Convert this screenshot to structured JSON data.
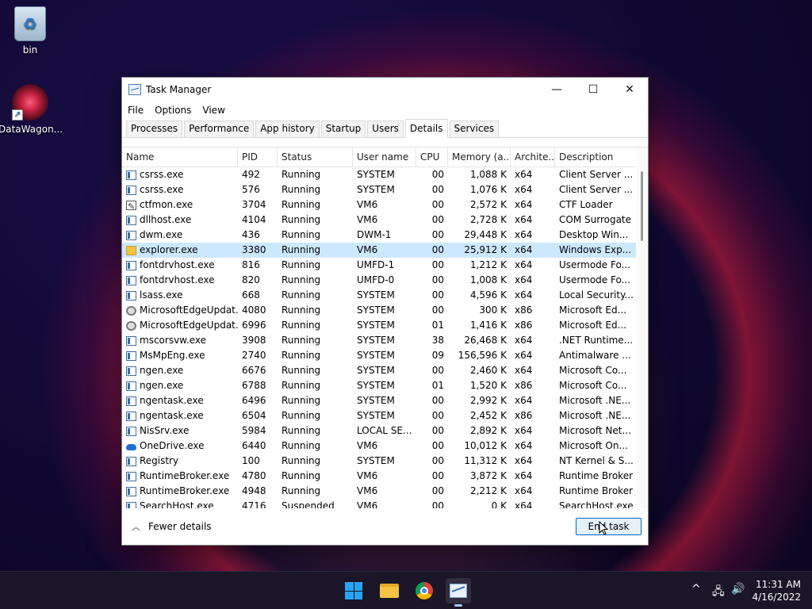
{
  "desktop": {
    "icons": [
      {
        "label": "bin"
      },
      {
        "label": "DataWagon..."
      }
    ]
  },
  "window": {
    "title": "Task Manager",
    "controls": {
      "minimize": "—",
      "maximize": "☐",
      "close": "✕"
    },
    "menu": [
      "File",
      "Options",
      "View"
    ],
    "tabs": [
      "Processes",
      "Performance",
      "App history",
      "Startup",
      "Users",
      "Details",
      "Services"
    ],
    "active_tab": "Details",
    "columns": [
      "Name",
      "PID",
      "Status",
      "User name",
      "CPU",
      "Memory (a...",
      "Archite...",
      "Description"
    ],
    "rows": [
      {
        "icon": "generic",
        "name": "csrss.exe",
        "pid": "492",
        "status": "Running",
        "user": "SYSTEM",
        "cpu": "00",
        "mem": "1,088 K",
        "arch": "x64",
        "desc": "Client Server ..."
      },
      {
        "icon": "generic",
        "name": "csrss.exe",
        "pid": "576",
        "status": "Running",
        "user": "SYSTEM",
        "cpu": "00",
        "mem": "1,076 K",
        "arch": "x64",
        "desc": "Client Server ..."
      },
      {
        "icon": "pen",
        "name": "ctfmon.exe",
        "pid": "3704",
        "status": "Running",
        "user": "VM6",
        "cpu": "00",
        "mem": "2,572 K",
        "arch": "x64",
        "desc": "CTF Loader"
      },
      {
        "icon": "generic",
        "name": "dllhost.exe",
        "pid": "4104",
        "status": "Running",
        "user": "VM6",
        "cpu": "00",
        "mem": "2,728 K",
        "arch": "x64",
        "desc": "COM Surrogate"
      },
      {
        "icon": "generic",
        "name": "dwm.exe",
        "pid": "436",
        "status": "Running",
        "user": "DWM-1",
        "cpu": "00",
        "mem": "29,448 K",
        "arch": "x64",
        "desc": "Desktop Win..."
      },
      {
        "icon": "folder",
        "name": "explorer.exe",
        "pid": "3380",
        "status": "Running",
        "user": "VM6",
        "cpu": "00",
        "mem": "25,912 K",
        "arch": "x64",
        "desc": "Windows Exp...",
        "selected": true
      },
      {
        "icon": "generic",
        "name": "fontdrvhost.exe",
        "pid": "816",
        "status": "Running",
        "user": "UMFD-1",
        "cpu": "00",
        "mem": "1,212 K",
        "arch": "x64",
        "desc": "Usermode Fo..."
      },
      {
        "icon": "generic",
        "name": "fontdrvhost.exe",
        "pid": "820",
        "status": "Running",
        "user": "UMFD-0",
        "cpu": "00",
        "mem": "1,008 K",
        "arch": "x64",
        "desc": "Usermode Fo..."
      },
      {
        "icon": "generic",
        "name": "lsass.exe",
        "pid": "668",
        "status": "Running",
        "user": "SYSTEM",
        "cpu": "00",
        "mem": "4,596 K",
        "arch": "x64",
        "desc": "Local Security..."
      },
      {
        "icon": "gear",
        "name": "MicrosoftEdgeUpdat...",
        "pid": "4080",
        "status": "Running",
        "user": "SYSTEM",
        "cpu": "00",
        "mem": "300 K",
        "arch": "x86",
        "desc": "Microsoft Ed..."
      },
      {
        "icon": "gear",
        "name": "MicrosoftEdgeUpdat...",
        "pid": "6996",
        "status": "Running",
        "user": "SYSTEM",
        "cpu": "01",
        "mem": "1,416 K",
        "arch": "x86",
        "desc": "Microsoft Ed..."
      },
      {
        "icon": "generic",
        "name": "mscorsvw.exe",
        "pid": "3908",
        "status": "Running",
        "user": "SYSTEM",
        "cpu": "38",
        "mem": "26,468 K",
        "arch": "x64",
        "desc": ".NET Runtime..."
      },
      {
        "icon": "generic",
        "name": "MsMpEng.exe",
        "pid": "2740",
        "status": "Running",
        "user": "SYSTEM",
        "cpu": "09",
        "mem": "156,596 K",
        "arch": "x64",
        "desc": "Antimalware ..."
      },
      {
        "icon": "generic",
        "name": "ngen.exe",
        "pid": "6676",
        "status": "Running",
        "user": "SYSTEM",
        "cpu": "00",
        "mem": "2,460 K",
        "arch": "x64",
        "desc": "Microsoft Co..."
      },
      {
        "icon": "generic",
        "name": "ngen.exe",
        "pid": "6788",
        "status": "Running",
        "user": "SYSTEM",
        "cpu": "01",
        "mem": "1,520 K",
        "arch": "x86",
        "desc": "Microsoft Co..."
      },
      {
        "icon": "generic",
        "name": "ngentask.exe",
        "pid": "6496",
        "status": "Running",
        "user": "SYSTEM",
        "cpu": "00",
        "mem": "2,992 K",
        "arch": "x64",
        "desc": "Microsoft .NE..."
      },
      {
        "icon": "generic",
        "name": "ngentask.exe",
        "pid": "6504",
        "status": "Running",
        "user": "SYSTEM",
        "cpu": "00",
        "mem": "2,452 K",
        "arch": "x86",
        "desc": "Microsoft .NE..."
      },
      {
        "icon": "generic",
        "name": "NisSrv.exe",
        "pid": "5984",
        "status": "Running",
        "user": "LOCAL SE...",
        "cpu": "00",
        "mem": "2,892 K",
        "arch": "x64",
        "desc": "Microsoft Net..."
      },
      {
        "icon": "cloud",
        "name": "OneDrive.exe",
        "pid": "6440",
        "status": "Running",
        "user": "VM6",
        "cpu": "00",
        "mem": "10,012 K",
        "arch": "x64",
        "desc": "Microsoft On..."
      },
      {
        "icon": "generic",
        "name": "Registry",
        "pid": "100",
        "status": "Running",
        "user": "SYSTEM",
        "cpu": "00",
        "mem": "11,312 K",
        "arch": "x64",
        "desc": "NT Kernel & S..."
      },
      {
        "icon": "generic",
        "name": "RuntimeBroker.exe",
        "pid": "4780",
        "status": "Running",
        "user": "VM6",
        "cpu": "00",
        "mem": "3,872 K",
        "arch": "x64",
        "desc": "Runtime Broker"
      },
      {
        "icon": "generic",
        "name": "RuntimeBroker.exe",
        "pid": "4948",
        "status": "Running",
        "user": "VM6",
        "cpu": "00",
        "mem": "2,212 K",
        "arch": "x64",
        "desc": "Runtime Broker"
      },
      {
        "icon": "generic",
        "name": "SearchHost.exe",
        "pid": "4716",
        "status": "Suspended",
        "user": "VM6",
        "cpu": "00",
        "mem": "0 K",
        "arch": "x64",
        "desc": "SearchHost.exe"
      }
    ],
    "footer": {
      "fewer_details": "Fewer details",
      "end_task": "End task"
    }
  },
  "taskbar": {
    "icons": [
      "start-icon",
      "file-explorer-icon",
      "chrome-icon",
      "task-manager-icon"
    ],
    "tray": {
      "chevron": "^",
      "network": "🖧",
      "volume": "🔊"
    },
    "clock": {
      "time": "11:31 AM",
      "date": "4/16/2022"
    }
  },
  "colors": {
    "selection": "#cce8ff",
    "accent": "#0067c0"
  }
}
